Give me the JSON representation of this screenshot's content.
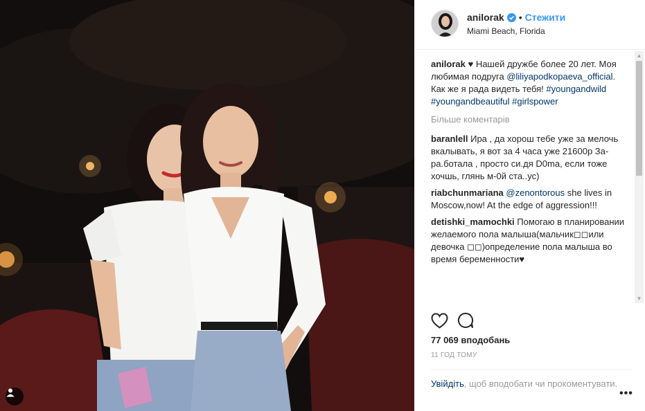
{
  "post": {
    "username": "anilorak",
    "separator": "•",
    "follow_label": "Стежити",
    "location": "Miami Beach, Florida"
  },
  "comments": {
    "caption": {
      "user": "anilorak",
      "text_before": "♥ Нашей дружбе более 20 лет. Моя любимая подруга",
      "mention": "@liliyapodkopaeva_official",
      "text_after": ". Как же я рада видеть тебя!",
      "hashtag1": "#youngandwild",
      "hashtag2": "#youngandbeautiful",
      "hashtag3": "#girlspower"
    },
    "load_more": "Більше коментарів",
    "items": [
      {
        "user": "baranlell",
        "text": "Ира , да хорош тебе уже за мелочь вкалывать, я вот за 4 часа уже 21600р За-ра.ботала , просто си.дя D0ma, если тоже хочшь, глянь м-0й ста..ус)"
      },
      {
        "user": "riabchunmariana",
        "mention": "@zenontorous",
        "text": " she lives in Moscow,now! At the edge of aggression!!!"
      },
      {
        "user": "detishki_mamochki",
        "text": "Помогаю в планировании желаемого пола малыша(мальчик◻◻или девочка ◻◻)определение пола малыша во время беременности♥"
      }
    ]
  },
  "stats": {
    "likes": "77 069 вподобань",
    "time": "11 ГОД ТОМУ"
  },
  "footer": {
    "login_link": "Увійдіть",
    "login_text": ", щоб вподобати чи прокоментувати.",
    "more": "•••"
  },
  "icons": {
    "like": "heart-icon",
    "comment": "comment-icon",
    "verified": "verified-badge-icon",
    "user_tag": "user-tag-icon"
  },
  "colors": {
    "link": "#003569",
    "follow": "#3897f0",
    "muted": "#999999",
    "text": "#262626"
  }
}
